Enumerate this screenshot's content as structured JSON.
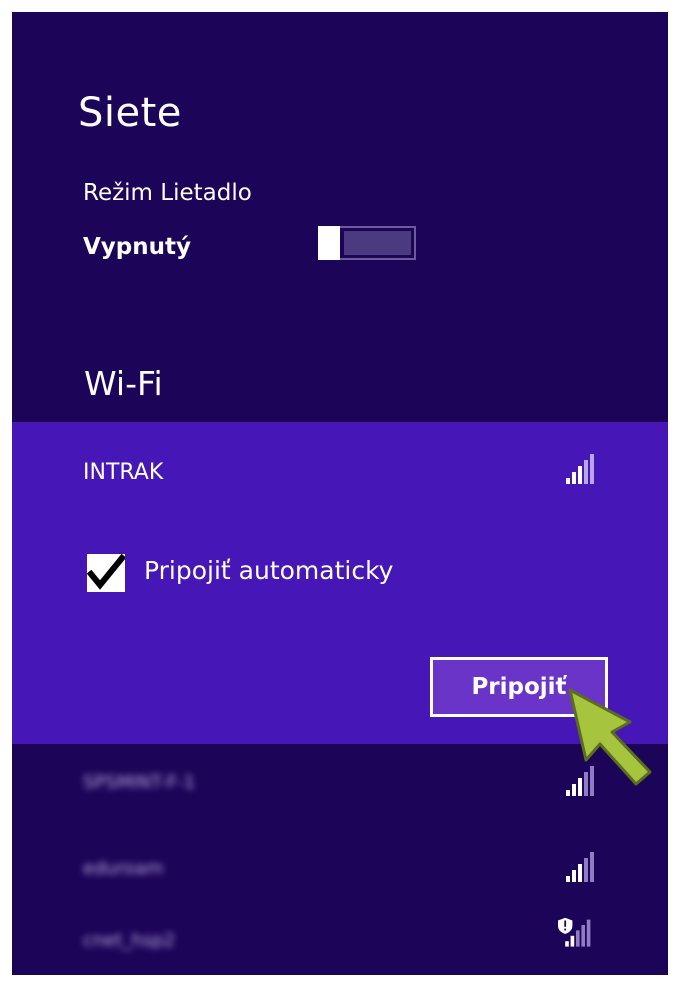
{
  "panel": {
    "title": "Siete",
    "background": "#1c0458",
    "accent": "#4617b6"
  },
  "airplane_mode": {
    "label": "Režim Lietadlo",
    "state": "Vypnutý",
    "on": false
  },
  "wifi": {
    "title": "Wi-Fi",
    "selected": {
      "name": "INTRAK",
      "signal_icon": "signal-bars-icon",
      "auto_connect_label": "Pripojiť automaticky",
      "auto_connect_checked": true,
      "connect_button_label": "Pripojiť"
    },
    "networks": [
      {
        "name": "SPSMINT-F-1",
        "signal_icon": "signal-bars-icon",
        "secured_warning": false
      },
      {
        "name": "eduroam",
        "signal_icon": "signal-bars-icon",
        "secured_warning": false
      },
      {
        "name": "cnet_hsp2",
        "signal_icon": "signal-bars-shield-icon",
        "secured_warning": true
      }
    ]
  },
  "cursor": {
    "icon": "arrow-cursor-icon",
    "color": "#a6c43d"
  }
}
